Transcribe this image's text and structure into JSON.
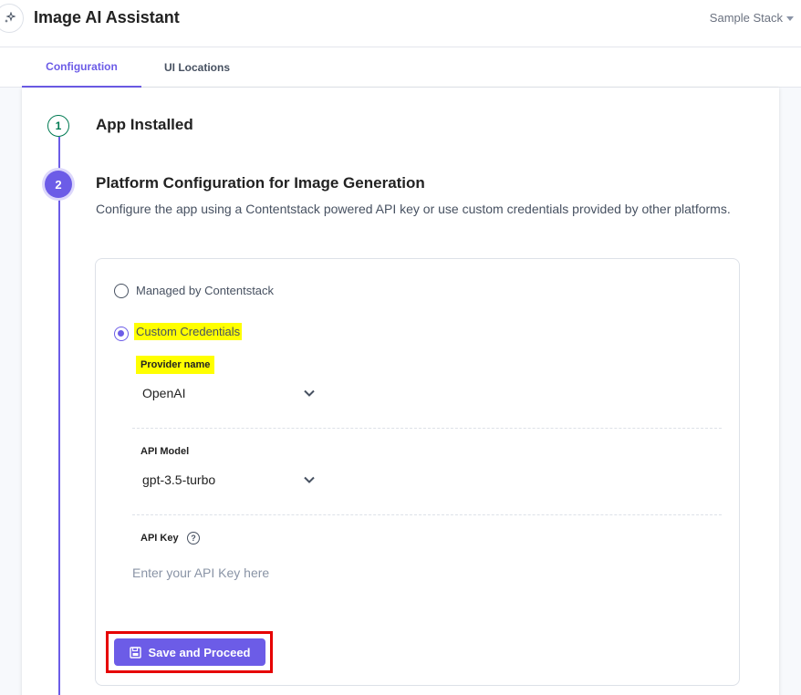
{
  "header": {
    "app_title": "Image AI Assistant",
    "stack_label": "Sample Stack"
  },
  "tabs": [
    {
      "label": "Configuration",
      "active": true
    },
    {
      "label": "UI Locations",
      "active": false
    }
  ],
  "steps": [
    {
      "number": "1",
      "title": "App Installed",
      "status": "completed"
    },
    {
      "number": "2",
      "title": "Platform Configuration for Image Generation",
      "description": "Configure the app using a Contentstack powered API key or use custom credentials provided by other platforms.",
      "status": "active"
    }
  ],
  "config": {
    "options": [
      {
        "label": "Managed by Contentstack",
        "selected": false
      },
      {
        "label": "Custom Credentials",
        "selected": true,
        "highlighted": true
      }
    ],
    "provider": {
      "label": "Provider name",
      "value": "OpenAI",
      "highlighted": true
    },
    "model": {
      "label": "API Model",
      "value": "gpt-3.5-turbo"
    },
    "api_key": {
      "label": "API Key",
      "placeholder": "Enter your API Key here",
      "value": ""
    },
    "save_button": {
      "label": "Save and Proceed",
      "annotated": true
    }
  },
  "colors": {
    "accent": "#6c5ce7",
    "success": "#007a52",
    "highlight": "#ffff00",
    "annotation": "#e60000"
  }
}
